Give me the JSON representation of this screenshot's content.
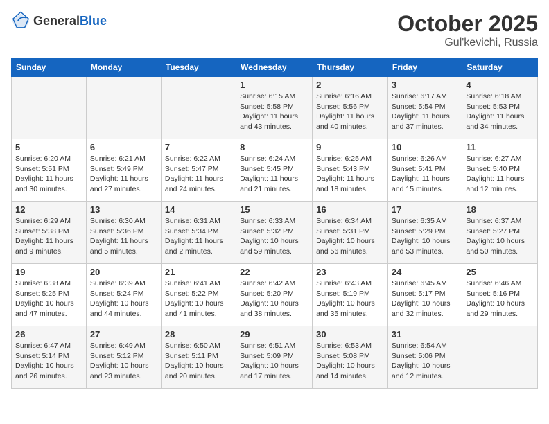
{
  "logo": {
    "general": "General",
    "blue": "Blue"
  },
  "header": {
    "month": "October 2025",
    "location": "Gul'kevichi, Russia"
  },
  "weekdays": [
    "Sunday",
    "Monday",
    "Tuesday",
    "Wednesday",
    "Thursday",
    "Friday",
    "Saturday"
  ],
  "weeks": [
    [
      {
        "day": null,
        "info": null
      },
      {
        "day": null,
        "info": null
      },
      {
        "day": null,
        "info": null
      },
      {
        "day": "1",
        "info": "Sunrise: 6:15 AM\nSunset: 5:58 PM\nDaylight: 11 hours\nand 43 minutes."
      },
      {
        "day": "2",
        "info": "Sunrise: 6:16 AM\nSunset: 5:56 PM\nDaylight: 11 hours\nand 40 minutes."
      },
      {
        "day": "3",
        "info": "Sunrise: 6:17 AM\nSunset: 5:54 PM\nDaylight: 11 hours\nand 37 minutes."
      },
      {
        "day": "4",
        "info": "Sunrise: 6:18 AM\nSunset: 5:53 PM\nDaylight: 11 hours\nand 34 minutes."
      }
    ],
    [
      {
        "day": "5",
        "info": "Sunrise: 6:20 AM\nSunset: 5:51 PM\nDaylight: 11 hours\nand 30 minutes."
      },
      {
        "day": "6",
        "info": "Sunrise: 6:21 AM\nSunset: 5:49 PM\nDaylight: 11 hours\nand 27 minutes."
      },
      {
        "day": "7",
        "info": "Sunrise: 6:22 AM\nSunset: 5:47 PM\nDaylight: 11 hours\nand 24 minutes."
      },
      {
        "day": "8",
        "info": "Sunrise: 6:24 AM\nSunset: 5:45 PM\nDaylight: 11 hours\nand 21 minutes."
      },
      {
        "day": "9",
        "info": "Sunrise: 6:25 AM\nSunset: 5:43 PM\nDaylight: 11 hours\nand 18 minutes."
      },
      {
        "day": "10",
        "info": "Sunrise: 6:26 AM\nSunset: 5:41 PM\nDaylight: 11 hours\nand 15 minutes."
      },
      {
        "day": "11",
        "info": "Sunrise: 6:27 AM\nSunset: 5:40 PM\nDaylight: 11 hours\nand 12 minutes."
      }
    ],
    [
      {
        "day": "12",
        "info": "Sunrise: 6:29 AM\nSunset: 5:38 PM\nDaylight: 11 hours\nand 9 minutes."
      },
      {
        "day": "13",
        "info": "Sunrise: 6:30 AM\nSunset: 5:36 PM\nDaylight: 11 hours\nand 5 minutes."
      },
      {
        "day": "14",
        "info": "Sunrise: 6:31 AM\nSunset: 5:34 PM\nDaylight: 11 hours\nand 2 minutes."
      },
      {
        "day": "15",
        "info": "Sunrise: 6:33 AM\nSunset: 5:32 PM\nDaylight: 10 hours\nand 59 minutes."
      },
      {
        "day": "16",
        "info": "Sunrise: 6:34 AM\nSunset: 5:31 PM\nDaylight: 10 hours\nand 56 minutes."
      },
      {
        "day": "17",
        "info": "Sunrise: 6:35 AM\nSunset: 5:29 PM\nDaylight: 10 hours\nand 53 minutes."
      },
      {
        "day": "18",
        "info": "Sunrise: 6:37 AM\nSunset: 5:27 PM\nDaylight: 10 hours\nand 50 minutes."
      }
    ],
    [
      {
        "day": "19",
        "info": "Sunrise: 6:38 AM\nSunset: 5:25 PM\nDaylight: 10 hours\nand 47 minutes."
      },
      {
        "day": "20",
        "info": "Sunrise: 6:39 AM\nSunset: 5:24 PM\nDaylight: 10 hours\nand 44 minutes."
      },
      {
        "day": "21",
        "info": "Sunrise: 6:41 AM\nSunset: 5:22 PM\nDaylight: 10 hours\nand 41 minutes."
      },
      {
        "day": "22",
        "info": "Sunrise: 6:42 AM\nSunset: 5:20 PM\nDaylight: 10 hours\nand 38 minutes."
      },
      {
        "day": "23",
        "info": "Sunrise: 6:43 AM\nSunset: 5:19 PM\nDaylight: 10 hours\nand 35 minutes."
      },
      {
        "day": "24",
        "info": "Sunrise: 6:45 AM\nSunset: 5:17 PM\nDaylight: 10 hours\nand 32 minutes."
      },
      {
        "day": "25",
        "info": "Sunrise: 6:46 AM\nSunset: 5:16 PM\nDaylight: 10 hours\nand 29 minutes."
      }
    ],
    [
      {
        "day": "26",
        "info": "Sunrise: 6:47 AM\nSunset: 5:14 PM\nDaylight: 10 hours\nand 26 minutes."
      },
      {
        "day": "27",
        "info": "Sunrise: 6:49 AM\nSunset: 5:12 PM\nDaylight: 10 hours\nand 23 minutes."
      },
      {
        "day": "28",
        "info": "Sunrise: 6:50 AM\nSunset: 5:11 PM\nDaylight: 10 hours\nand 20 minutes."
      },
      {
        "day": "29",
        "info": "Sunrise: 6:51 AM\nSunset: 5:09 PM\nDaylight: 10 hours\nand 17 minutes."
      },
      {
        "day": "30",
        "info": "Sunrise: 6:53 AM\nSunset: 5:08 PM\nDaylight: 10 hours\nand 14 minutes."
      },
      {
        "day": "31",
        "info": "Sunrise: 6:54 AM\nSunset: 5:06 PM\nDaylight: 10 hours\nand 12 minutes."
      },
      {
        "day": null,
        "info": null
      }
    ]
  ]
}
